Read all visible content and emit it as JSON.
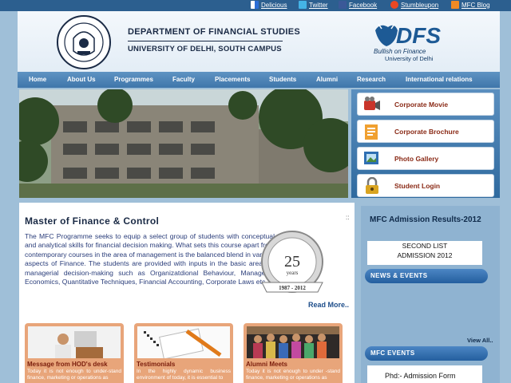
{
  "topbar": {
    "links": [
      {
        "label": "Delicious",
        "icon": "delicious-icon"
      },
      {
        "label": "Twitter",
        "icon": "twitter-icon"
      },
      {
        "label": "Facebook",
        "icon": "facebook-icon"
      },
      {
        "label": "Stumbleupon",
        "icon": "stumbleupon-icon"
      },
      {
        "label": "MFC Blog",
        "icon": "rss-icon"
      }
    ]
  },
  "header": {
    "dept_title": "DEPARTMENT OF FINANCIAL STUDIES",
    "univ_title": "UNIVERSITY OF DELHI, SOUTH CAMPUS",
    "logo_text": "DFS",
    "logo_tagline": "Bullish on Finance",
    "logo_sub": "University of Delhi"
  },
  "nav": {
    "items": [
      "Home",
      "About Us",
      "Programmes",
      "Faculty",
      "Placements",
      "Students",
      "Alumni",
      "Research",
      "International relations"
    ]
  },
  "side_panel": {
    "buttons": [
      {
        "label": "Corporate Movie",
        "icon": "video-camera-icon"
      },
      {
        "label": "Corporate Brochure",
        "icon": "brochure-icon"
      },
      {
        "label": "Photo Gallery",
        "icon": "photo-frame-icon"
      },
      {
        "label": "Student Login",
        "icon": "lock-icon"
      }
    ]
  },
  "main": {
    "title": "Master of Finance & Control",
    "dots": "::",
    "body": "The MFC Programme seeks to equip a select group of students with conceptual and analytical skills for financial decision making. What sets this course apart from contemporary courses in the area of management is the balanced blend in various aspects of Finance. The students are provided with inputs in the basic areas of managerial decision-making such as Organizatdional Behaviour, Managerial Economics, Quantitative Techniques, Financial Accounting, Corporate Laws etc.",
    "badge_number": "25",
    "badge_word": "years",
    "badge_years": "1987 - 2012",
    "read_more": "Read More..",
    "cards": [
      {
        "title": "Message from HOD's desk",
        "text": "Today it is not enough to under-stand finance, marketing or operations as"
      },
      {
        "title": "Testimonials",
        "text": "In the highly dynamic business environment of today, it is essential to"
      },
      {
        "title": "Alumni Meets",
        "text": "Today it is not enough to under -stand finance, marketing or operations as"
      }
    ]
  },
  "right": {
    "title": "MFC Admission Results-2012",
    "result_line1": "SECOND LIST",
    "result_line2": "ADMISSION 2012",
    "news_label": "NEWS & EVENTS",
    "view_all": "View All..",
    "events_label": "MFC EVENTS",
    "event_item": "Phd:- Admission Form"
  },
  "colors": {
    "topbar": "#2c5f8f",
    "nav": "#4f86bb",
    "card": "#e8a57a",
    "side_label": "#8a2a16",
    "body_text": "#2a3d7a"
  }
}
